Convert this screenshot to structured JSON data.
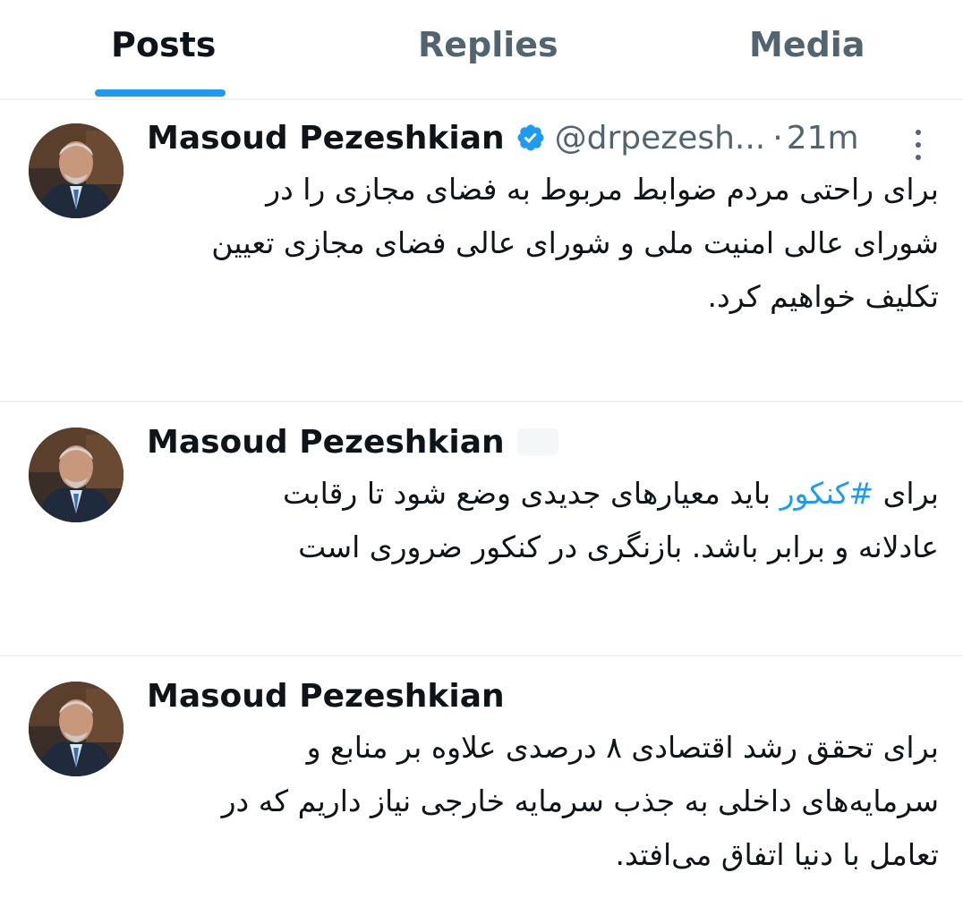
{
  "tabs": [
    {
      "label": "Posts",
      "active": true
    },
    {
      "label": "Replies",
      "active": false
    },
    {
      "label": "Media",
      "active": false
    }
  ],
  "colors": {
    "accent": "#1d9bf0",
    "text": "#0f1419",
    "secondary": "#536471"
  },
  "tweets": [
    {
      "author": "Masoud Pezeshkian",
      "verified": true,
      "handle": "@drpezesh...",
      "separator": "·",
      "time": "21m",
      "lines": [
        "برای راحتی مردم ضوابط مربوط به فضای مجازی را در",
        "شورای عالی امنیت ملی و شورای عالی فضای مجازی تعیین",
        "تکلیف خواهیم کرد."
      ]
    },
    {
      "author": "Masoud Pezeshkian",
      "line1_prefix": "برای ",
      "hashtag": "#کنکور",
      "line1_suffix": " باید معیارهای جدیدی وضع شود تا رقابت",
      "line2": "عادلانه و برابر باشد. بازنگری در کنکور ضروری است"
    },
    {
      "author": "Masoud Pezeshkian",
      "lines": [
        "برای تحقق رشد اقتصادی ۸ درصدی علاوه بر منابع و",
        "سرمایه‌های داخلی به جذب سرمایه خارجی نیاز داریم که در",
        "تعامل با دنیا اتفاق می‌افتد."
      ]
    }
  ]
}
